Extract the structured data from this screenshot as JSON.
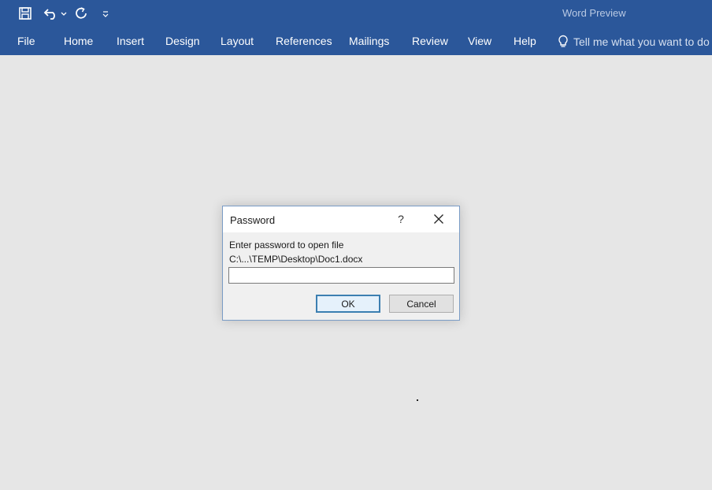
{
  "app": {
    "title": "Word Preview"
  },
  "quick_access": {
    "save_icon": "save-icon",
    "undo_icon": "undo-icon",
    "redo_icon": "redo-icon",
    "customize_icon": "customize-icon"
  },
  "ribbon": {
    "tabs": [
      {
        "label": "File"
      },
      {
        "label": "Home"
      },
      {
        "label": "Insert"
      },
      {
        "label": "Design"
      },
      {
        "label": "Layout"
      },
      {
        "label": "References"
      },
      {
        "label": "Mailings"
      },
      {
        "label": "Review"
      },
      {
        "label": "View"
      },
      {
        "label": "Help"
      }
    ],
    "tell_me": "Tell me what you want to do"
  },
  "dialog": {
    "title": "Password",
    "help_label": "?",
    "prompt": "Enter password to open file",
    "file_path": "C:\\...\\TEMP\\Desktop\\Doc1.docx",
    "password_value": "",
    "ok_label": "OK",
    "cancel_label": "Cancel"
  },
  "colors": {
    "ribbon": "#2b579a",
    "workspace": "#e6e6e6"
  }
}
